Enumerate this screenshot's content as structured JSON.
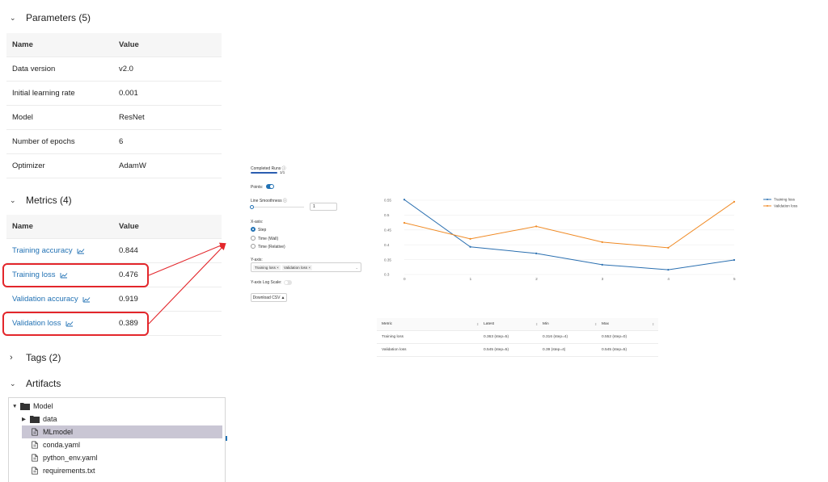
{
  "parameters": {
    "section_title": "Parameters (5)",
    "columns": [
      "Name",
      "Value"
    ],
    "rows": [
      {
        "name": "Data version",
        "value": "v2.0"
      },
      {
        "name": "Initial learning rate",
        "value": "0.001"
      },
      {
        "name": "Model",
        "value": "ResNet"
      },
      {
        "name": "Number of epochs",
        "value": "6"
      },
      {
        "name": "Optimizer",
        "value": "AdamW"
      }
    ]
  },
  "metrics": {
    "section_title": "Metrics (4)",
    "columns": [
      "Name",
      "Value"
    ],
    "rows": [
      {
        "name": "Training accuracy",
        "value": "0.844",
        "highlighted": false
      },
      {
        "name": "Training loss",
        "value": "0.476",
        "highlighted": true
      },
      {
        "name": "Validation accuracy",
        "value": "0.919",
        "highlighted": false
      },
      {
        "name": "Validation loss",
        "value": "0.389",
        "highlighted": true
      }
    ]
  },
  "tags": {
    "section_title": "Tags (2)"
  },
  "artifacts": {
    "section_title": "Artifacts",
    "tree": [
      {
        "label": "Model",
        "type": "folder",
        "expanded": true,
        "depth": 0,
        "selected": false
      },
      {
        "label": "data",
        "type": "folder",
        "expanded": false,
        "depth": 1,
        "selected": false
      },
      {
        "label": "MLmodel",
        "type": "file",
        "depth": 1,
        "selected": true
      },
      {
        "label": "conda.yaml",
        "type": "file",
        "depth": 1,
        "selected": false
      },
      {
        "label": "python_env.yaml",
        "type": "file",
        "depth": 1,
        "selected": false
      },
      {
        "label": "requirements.txt",
        "type": "file",
        "depth": 1,
        "selected": false
      }
    ]
  },
  "controls": {
    "completed_runs_label": "Completed Runs",
    "completed_runs_count": "1/1",
    "completed_runs_fraction": 1.0,
    "points_label": "Points:",
    "points_on": true,
    "smoothness_label": "Line Smoothness",
    "smoothness_value": "1",
    "xaxis_label": "X-axis:",
    "xaxis_options": [
      {
        "label": "Step",
        "selected": true
      },
      {
        "label": "Time (Wall)",
        "selected": false
      },
      {
        "label": "Time (Relative)",
        "selected": false
      }
    ],
    "yaxis_label": "Y-axis:",
    "yaxis_chips": [
      "Training loss",
      "Validation loss"
    ],
    "ylog_label": "Y-axis Log Scale:",
    "ylog_on": false,
    "download_label": "Download CSV"
  },
  "chart_data": {
    "type": "line",
    "x": [
      0,
      1,
      2,
      3,
      4,
      5
    ],
    "series": [
      {
        "name": "Training loss",
        "color": "#2a6fb0",
        "values": [
          0.552,
          0.393,
          0.371,
          0.333,
          0.316,
          0.349
        ]
      },
      {
        "name": "Validation loss",
        "color": "#f08a24",
        "values": [
          0.474,
          0.42,
          0.462,
          0.409,
          0.39,
          0.545
        ]
      }
    ],
    "xlabel": "",
    "ylabel": "",
    "yticks": [
      "0.55",
      "0.5",
      "0.45",
      "0.4",
      "0.35",
      "0.3"
    ],
    "xticks": [
      "0",
      "1",
      "2",
      "3",
      "4",
      "5"
    ],
    "ylim": [
      0.3,
      0.55
    ],
    "xlim": [
      0,
      5
    ],
    "grid": true,
    "legend": "top-right"
  },
  "metric_table": {
    "columns": [
      "Metric",
      "Latest",
      "Min",
      "Max"
    ],
    "rows": [
      {
        "metric": "Training loss",
        "latest": "0.363 (step=5)",
        "min": "0.316 (step=4)",
        "max": "0.552 (step=0)"
      },
      {
        "metric": "Validation loss",
        "latest": "0.545 (step=5)",
        "min": "0.39 (step=4)",
        "max": "0.545 (step=5)"
      }
    ]
  },
  "colors": {
    "accent": "#2272b4",
    "highlight": "#e3262b",
    "selected_row": "#c9c6d4"
  }
}
